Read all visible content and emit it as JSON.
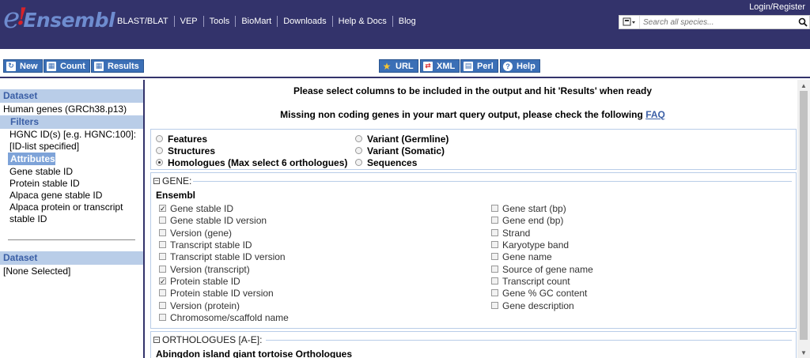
{
  "brand": {
    "e": "e",
    "bang": "!",
    "name": "Ensembl"
  },
  "topnav": [
    "BLAST/BLAT",
    "VEP",
    "Tools",
    "BioMart",
    "Downloads",
    "Help & Docs",
    "Blog"
  ],
  "login": "Login/Register",
  "search": {
    "placeholder": "Search all species..."
  },
  "toolbar": {
    "new": "New",
    "count": "Count",
    "results": "Results",
    "url": "URL",
    "xml": "XML",
    "perl": "Perl",
    "help": "Help"
  },
  "sidebar": {
    "dataset1": "Dataset",
    "dataset1_value": "Human genes (GRCh38.p13)",
    "filters": "Filters",
    "filter_line1": "HGNC ID(s) [e.g. HGNC:100]:",
    "filter_line2": "[ID-list specified]",
    "attributes": "Attributes",
    "attr_items": [
      "Gene stable ID",
      "Protein stable ID",
      "Alpaca gene stable ID",
      "Alpaca protein or transcript",
      "stable ID"
    ],
    "dataset2": "Dataset",
    "dataset2_value": "[None Selected]"
  },
  "main": {
    "msg1": "Please select columns to be included in the output and hit 'Results' when ready",
    "msg2": "Missing non coding genes in your mart query output, please check the following",
    "faq": "FAQ",
    "radios": [
      {
        "label": "Features",
        "checked": false
      },
      {
        "label": "Structures",
        "checked": false
      },
      {
        "label": "Homologues (Max select 6 orthologues)",
        "checked": true
      },
      {
        "label": "Variant (Germline)",
        "checked": false
      },
      {
        "label": "Variant (Somatic)",
        "checked": false
      },
      {
        "label": "Sequences",
        "checked": false
      }
    ],
    "gene_title": "GENE:",
    "ensembl_label": "Ensembl",
    "left_checks": [
      {
        "label": "Gene stable ID",
        "checked": true
      },
      {
        "label": "Gene stable ID version",
        "checked": false
      },
      {
        "label": "Version (gene)",
        "checked": false
      },
      {
        "label": "Transcript stable ID",
        "checked": false
      },
      {
        "label": "Transcript stable ID version",
        "checked": false
      },
      {
        "label": "Version (transcript)",
        "checked": false
      },
      {
        "label": "Protein stable ID",
        "checked": true
      },
      {
        "label": "Protein stable ID version",
        "checked": false
      },
      {
        "label": "Version (protein)",
        "checked": false
      },
      {
        "label": "Chromosome/scaffold name",
        "checked": false
      }
    ],
    "right_checks": [
      {
        "label": "Gene start (bp)",
        "checked": false
      },
      {
        "label": "Gene end (bp)",
        "checked": false
      },
      {
        "label": "Strand",
        "checked": false
      },
      {
        "label": "Karyotype band",
        "checked": false
      },
      {
        "label": "Gene name",
        "checked": false
      },
      {
        "label": "Source of gene name",
        "checked": false
      },
      {
        "label": "Transcript count",
        "checked": false
      },
      {
        "label": "Gene % GC content",
        "checked": false
      },
      {
        "label": "Gene description",
        "checked": false
      }
    ],
    "orth_title": "ORTHOLOGUES [A-E]:",
    "orth_sub": "Abingdon island giant tortoise Orthologues"
  },
  "colors": {
    "header": "#33336b",
    "accent": "#3b6fb6",
    "sidebar_head": "#b9cde8"
  }
}
